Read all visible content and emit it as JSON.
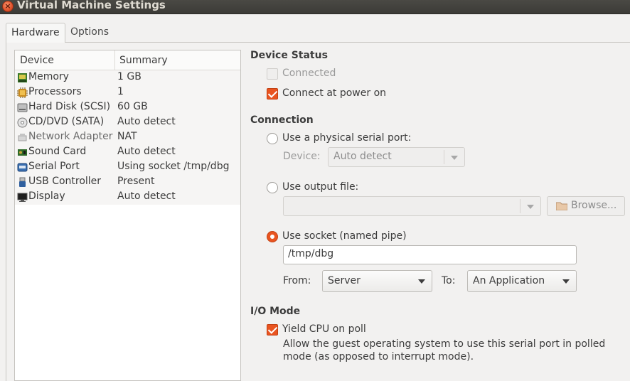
{
  "window": {
    "title": "Virtual Machine Settings"
  },
  "tabs": [
    {
      "label": "Hardware",
      "active": true
    },
    {
      "label": "Options",
      "active": false
    }
  ],
  "device_list": {
    "columns": [
      "Device",
      "Summary"
    ],
    "rows": [
      {
        "icon": "memory-icon",
        "name": "Memory",
        "summary": "1 GB"
      },
      {
        "icon": "processor-icon",
        "name": "Processors",
        "summary": "1"
      },
      {
        "icon": "hard-disk-icon",
        "name": "Hard Disk (SCSI)",
        "summary": "60 GB"
      },
      {
        "icon": "cd-dvd-icon",
        "name": "CD/DVD (SATA)",
        "summary": "Auto detect"
      },
      {
        "icon": "network-icon",
        "name": "Network Adapter",
        "summary": "NAT"
      },
      {
        "icon": "sound-card-icon",
        "name": "Sound Card",
        "summary": "Auto detect"
      },
      {
        "icon": "serial-port-icon",
        "name": "Serial Port",
        "summary": "Using socket /tmp/dbg"
      },
      {
        "icon": "usb-icon",
        "name": "USB Controller",
        "summary": "Present"
      },
      {
        "icon": "display-icon",
        "name": "Display",
        "summary": "Auto detect"
      }
    ]
  },
  "device_status": {
    "heading": "Device Status",
    "connected": {
      "label": "Connected",
      "checked": false,
      "enabled": false
    },
    "connect_at_power_on": {
      "label": "Connect at power on",
      "checked": true
    }
  },
  "connection": {
    "heading": "Connection",
    "physical": {
      "label": "Use a physical serial port:",
      "selected": false,
      "device_label": "Device:",
      "device_value": "Auto detect"
    },
    "output_file": {
      "label": "Use output file:",
      "selected": false,
      "path_value": "",
      "browse_label": "Browse..."
    },
    "socket": {
      "label": "Use socket (named pipe)",
      "selected": true,
      "path_value": "/tmp/dbg",
      "from_label": "From:",
      "from_value": "Server",
      "to_label": "To:",
      "to_value": "An Application"
    }
  },
  "io_mode": {
    "heading": "I/O Mode",
    "yield_cpu": {
      "label": "Yield CPU on poll",
      "checked": true
    },
    "description": "Allow the guest operating system to use this serial port in polled mode (as opposed to interrupt mode)."
  },
  "colors": {
    "accent": "#e95420",
    "title_bar": "#3c3b37"
  }
}
